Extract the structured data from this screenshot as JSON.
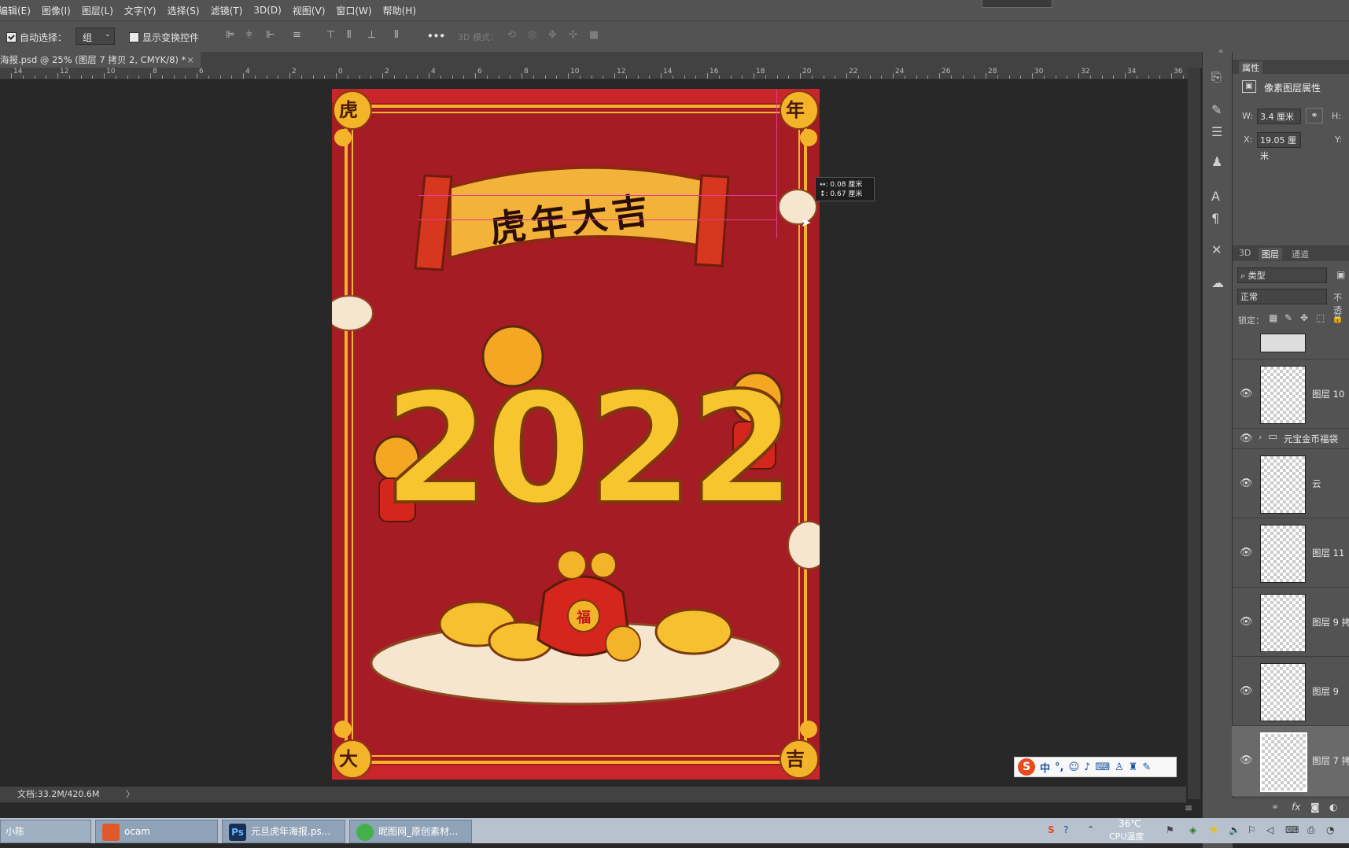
{
  "menubar": {
    "items": [
      "编辑(E)",
      "图像(I)",
      "图层(L)",
      "文字(Y)",
      "选择(S)",
      "滤镜(T)",
      "3D(D)",
      "视图(V)",
      "窗口(W)",
      "帮助(H)"
    ]
  },
  "options": {
    "auto_select_label": "自动选择：",
    "auto_select_value": "组",
    "show_transform_label": "显示变换控件",
    "more_label": "•••",
    "mode_3d_label": "3D 模式："
  },
  "document": {
    "tab_title": "海报.psd @ 25% (图层 7 拷贝 2, CMYK/8) *",
    "tab_close": "×"
  },
  "ruler": {
    "labels": [
      "14",
      "12",
      "10",
      "8",
      "6",
      "4",
      "2",
      "0",
      "2",
      "4",
      "6",
      "8",
      "10",
      "12",
      "14",
      "16",
      "18",
      "20",
      "22",
      "24",
      "26",
      "28",
      "30",
      "32",
      "34",
      "36"
    ]
  },
  "measure": {
    "line1": "↔: 0.08 厘米",
    "line2": "↕: 0.67 厘米"
  },
  "poster": {
    "corner_tl": "虎",
    "corner_tr": "年",
    "corner_bl": "大",
    "corner_br": "吉",
    "scroll_text": "虎年大吉",
    "year": "2022",
    "bag_char": "福"
  },
  "status": {
    "doc_info": "文档:33.2M/420.6M",
    "arrow": "〉"
  },
  "ime": {
    "label": "中",
    "punct": "°,"
  },
  "properties_panel": {
    "tab": "属性",
    "heading": "像素图层属性",
    "w_label": "W:",
    "w_value": "3.4 厘米",
    "h_label": "H:",
    "x_label": "X:",
    "x_value": "19.05 厘米",
    "y_label": "Y:"
  },
  "layers_panel": {
    "tabs": [
      "3D",
      "图层",
      "通道"
    ],
    "filter_value": "类型",
    "blend_mode": "正常",
    "opacity_label": "不透",
    "lock_label": "锁定：",
    "layers": [
      {
        "name": "图层 10"
      },
      {
        "name": "元宝金币福袋"
      },
      {
        "name": "云"
      },
      {
        "name": "图层 11"
      },
      {
        "name": "图层 9 拷"
      },
      {
        "name": "图层 9"
      },
      {
        "name": "图层 7 拷"
      }
    ],
    "footer_icons": [
      "link-icon",
      "fx-icon",
      "mask-icon",
      "adjustment-icon"
    ]
  },
  "taskbar": {
    "start_label": "小陈",
    "tasks": [
      {
        "label": "ocam",
        "color": "#e0592a"
      },
      {
        "label": "元旦虎年海报.ps...",
        "color": "#1a2f56"
      },
      {
        "label": "昵图网_原创素材...",
        "color": "#44b04a"
      }
    ],
    "temperature": "36℃",
    "cpu_label": "CPU温度"
  },
  "colors": {
    "ps_panel": "#535353",
    "canvas_bg": "#282828",
    "poster_red": "#a51c24",
    "gold": "#f4b42a",
    "guide": "#e33d8e"
  }
}
